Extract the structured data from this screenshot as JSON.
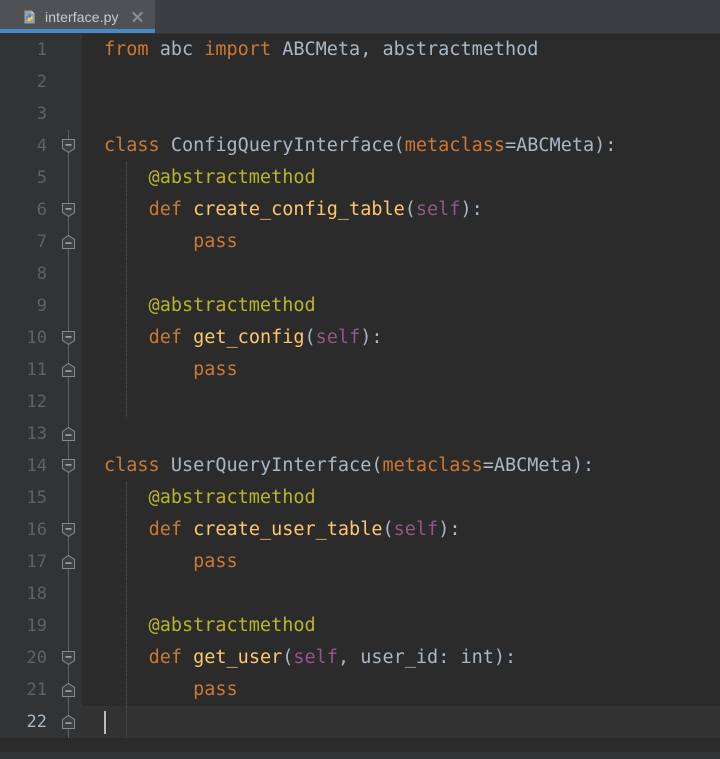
{
  "window": {
    "background": "#2b2b2b",
    "accent": "#4a88c7"
  },
  "tabbar": {
    "tabs": [
      {
        "label": "interface.py",
        "icon": "python-file-icon",
        "close_icon": "close-icon",
        "active": true
      }
    ]
  },
  "editor": {
    "language": "Python",
    "cursor_line": 22,
    "total_lines": 22,
    "colors": {
      "keyword": "#cc7832",
      "function": "#ffc66d",
      "decorator": "#bbb529",
      "self": "#94558d",
      "text": "#a9b7c6",
      "gutter_text": "#606366",
      "gutter_bg": "#313335",
      "editor_bg": "#2b2b2b",
      "active_line_bg": "#323232",
      "caret": "#bcbcbc"
    },
    "lines": [
      {
        "num": "1",
        "fold": "none",
        "indent": false,
        "tokens": [
          {
            "t": "from",
            "c": "k"
          },
          {
            "t": " ",
            "c": "pl"
          },
          {
            "t": "abc",
            "c": "pl"
          },
          {
            "t": " ",
            "c": "pl"
          },
          {
            "t": "import",
            "c": "k"
          },
          {
            "t": " ",
            "c": "pl"
          },
          {
            "t": "ABCMeta, abstractmethod",
            "c": "pl"
          }
        ]
      },
      {
        "num": "2",
        "fold": "none",
        "indent": false,
        "tokens": []
      },
      {
        "num": "3",
        "fold": "none",
        "indent": false,
        "tokens": []
      },
      {
        "num": "4",
        "fold": "start",
        "indent": false,
        "tokens": [
          {
            "t": "class",
            "c": "k"
          },
          {
            "t": " ",
            "c": "pl"
          },
          {
            "t": "ConfigQueryInterface",
            "c": "cls"
          },
          {
            "t": "(",
            "c": "pl"
          },
          {
            "t": "metaclass",
            "c": "kw2"
          },
          {
            "t": "=",
            "c": "pl"
          },
          {
            "t": "ABCMeta",
            "c": "cls"
          },
          {
            "t": "):",
            "c": "pl"
          }
        ]
      },
      {
        "num": "5",
        "fold": "line",
        "indent": true,
        "tokens": [
          {
            "t": "    @abstractmethod",
            "c": "dec"
          }
        ]
      },
      {
        "num": "6",
        "fold": "start-inner",
        "indent": true,
        "tokens": [
          {
            "t": "    ",
            "c": "pl"
          },
          {
            "t": "def",
            "c": "k"
          },
          {
            "t": " ",
            "c": "pl"
          },
          {
            "t": "create_config_table",
            "c": "fn"
          },
          {
            "t": "(",
            "c": "pl"
          },
          {
            "t": "self",
            "c": "slf"
          },
          {
            "t": "):",
            "c": "pl"
          }
        ]
      },
      {
        "num": "7",
        "fold": "end-inner",
        "indent": true,
        "tokens": [
          {
            "t": "        ",
            "c": "pl"
          },
          {
            "t": "pass",
            "c": "k"
          }
        ]
      },
      {
        "num": "8",
        "fold": "line",
        "indent": true,
        "tokens": []
      },
      {
        "num": "9",
        "fold": "line",
        "indent": true,
        "tokens": [
          {
            "t": "    @abstractmethod",
            "c": "dec"
          }
        ]
      },
      {
        "num": "10",
        "fold": "start-inner",
        "indent": true,
        "tokens": [
          {
            "t": "    ",
            "c": "pl"
          },
          {
            "t": "def",
            "c": "k"
          },
          {
            "t": " ",
            "c": "pl"
          },
          {
            "t": "get_config",
            "c": "fn"
          },
          {
            "t": "(",
            "c": "pl"
          },
          {
            "t": "self",
            "c": "slf"
          },
          {
            "t": "):",
            "c": "pl"
          }
        ]
      },
      {
        "num": "11",
        "fold": "end-inner",
        "indent": true,
        "tokens": [
          {
            "t": "        ",
            "c": "pl"
          },
          {
            "t": "pass",
            "c": "k"
          }
        ]
      },
      {
        "num": "12",
        "fold": "line",
        "indent": true,
        "tokens": []
      },
      {
        "num": "13",
        "fold": "end",
        "indent": false,
        "tokens": []
      },
      {
        "num": "14",
        "fold": "start",
        "indent": false,
        "tokens": [
          {
            "t": "class",
            "c": "k"
          },
          {
            "t": " ",
            "c": "pl"
          },
          {
            "t": "UserQueryInterface",
            "c": "cls"
          },
          {
            "t": "(",
            "c": "pl"
          },
          {
            "t": "metaclass",
            "c": "kw2"
          },
          {
            "t": "=",
            "c": "pl"
          },
          {
            "t": "ABCMeta",
            "c": "cls"
          },
          {
            "t": "):",
            "c": "pl"
          }
        ]
      },
      {
        "num": "15",
        "fold": "line",
        "indent": true,
        "tokens": [
          {
            "t": "    @abstractmethod",
            "c": "dec"
          }
        ]
      },
      {
        "num": "16",
        "fold": "start-inner",
        "indent": true,
        "tokens": [
          {
            "t": "    ",
            "c": "pl"
          },
          {
            "t": "def",
            "c": "k"
          },
          {
            "t": " ",
            "c": "pl"
          },
          {
            "t": "create_user_table",
            "c": "fn"
          },
          {
            "t": "(",
            "c": "pl"
          },
          {
            "t": "self",
            "c": "slf"
          },
          {
            "t": "):",
            "c": "pl"
          }
        ]
      },
      {
        "num": "17",
        "fold": "end-inner",
        "indent": true,
        "tokens": [
          {
            "t": "        ",
            "c": "pl"
          },
          {
            "t": "pass",
            "c": "k"
          }
        ]
      },
      {
        "num": "18",
        "fold": "line",
        "indent": true,
        "tokens": []
      },
      {
        "num": "19",
        "fold": "line",
        "indent": true,
        "tokens": [
          {
            "t": "    @abstractmethod",
            "c": "dec"
          }
        ]
      },
      {
        "num": "20",
        "fold": "start-inner",
        "indent": true,
        "tokens": [
          {
            "t": "    ",
            "c": "pl"
          },
          {
            "t": "def",
            "c": "k"
          },
          {
            "t": " ",
            "c": "pl"
          },
          {
            "t": "get_user",
            "c": "fn"
          },
          {
            "t": "(",
            "c": "pl"
          },
          {
            "t": "self",
            "c": "slf"
          },
          {
            "t": ", ",
            "c": "pl"
          },
          {
            "t": "user_id",
            "c": "pl"
          },
          {
            "t": ": ",
            "c": "pl"
          },
          {
            "t": "int",
            "c": "pl"
          },
          {
            "t": "):",
            "c": "pl"
          }
        ]
      },
      {
        "num": "21",
        "fold": "end-inner",
        "indent": true,
        "tokens": [
          {
            "t": "        ",
            "c": "pl"
          },
          {
            "t": "pass",
            "c": "k"
          }
        ]
      },
      {
        "num": "22",
        "fold": "end",
        "indent": true,
        "active": true,
        "caret": true,
        "tokens": []
      }
    ]
  }
}
